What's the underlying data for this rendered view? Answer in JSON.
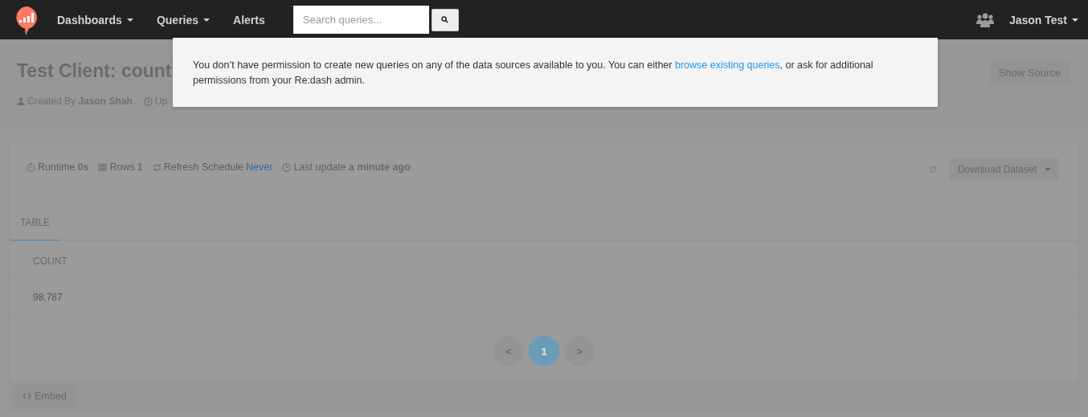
{
  "navbar": {
    "menu": [
      {
        "label": "Dashboards",
        "dropdown": true
      },
      {
        "label": "Queries",
        "dropdown": true
      },
      {
        "label": "Alerts",
        "dropdown": false
      }
    ],
    "search": {
      "placeholder": "Search queries..."
    },
    "user": {
      "name": "Jason Test",
      "dropdown": true
    }
  },
  "notice": {
    "before": "You don’t have permission to create new queries on any of the data sources available to you. You can either ",
    "link": "browse existing queries",
    "after": ", or ask for additional permissions from your Re:dash admin."
  },
  "query": {
    "title": "Test Client: count",
    "meta": [
      {
        "kind": "person",
        "label": "Created By",
        "value": "Jason Shah"
      },
      {
        "kind": "clock",
        "label": "Up"
      }
    ],
    "show_source": "Show Source"
  },
  "stats": [
    {
      "kind": "timer",
      "label": "Runtime",
      "value": "0s",
      "link": false
    },
    {
      "kind": "rows",
      "label": "Rows",
      "value": "1",
      "link": false
    },
    {
      "kind": "refresh",
      "label": "Refresh Schedule",
      "value": "Never",
      "link": true
    },
    {
      "kind": "clock",
      "label": "Last update",
      "value": "a minute ago",
      "link": false
    }
  ],
  "download": "Download Dataset",
  "tabs": [
    {
      "label": "TABLE",
      "selected": true
    }
  ],
  "table": {
    "columns": [
      "COUNT"
    ],
    "rows": [
      [
        "98,787"
      ]
    ]
  },
  "pagination": {
    "prev": "<",
    "pages": [
      {
        "label": "1",
        "selected": true
      }
    ],
    "next": ">"
  },
  "embed": "Embed"
}
